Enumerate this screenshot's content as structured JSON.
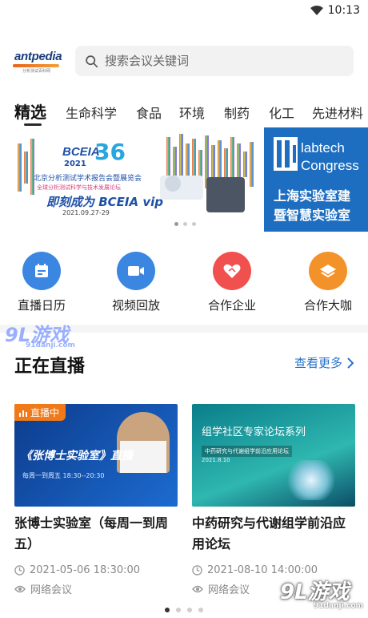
{
  "status_bar": {
    "time": "10:13"
  },
  "header": {
    "logo_text": "antpedia",
    "logo_sub": "分析测试百科网",
    "search_placeholder": "搜索会议关键词"
  },
  "tabs": [
    "精选",
    "生命科学",
    "食品",
    "环境",
    "制药",
    "化工",
    "先进材料"
  ],
  "banners": {
    "main": {
      "brand": "BCEIA",
      "year_badge": "2021",
      "anniversary": "36",
      "line1": "北京分析测试学术报告会暨展览会",
      "line2": "全球分析测试科学与技术发展论坛",
      "cta": "即刻成为 BCEIA vip",
      "date": "2021.09.27-29"
    },
    "side": {
      "title_line1": "labtech",
      "title_line2": "Congress",
      "subtitle_line1": "上海实验室建",
      "subtitle_line2": "暨智慧实验室"
    }
  },
  "shortcuts": [
    {
      "label": "直播日历",
      "icon": "calendar-icon",
      "color": "#3a86e0"
    },
    {
      "label": "视频回放",
      "icon": "video-icon",
      "color": "#3a86e0"
    },
    {
      "label": "合作企业",
      "icon": "heart-handshake-icon",
      "color": "#f0504e"
    },
    {
      "label": "合作大咖",
      "icon": "layers-icon",
      "color": "#f4922a"
    }
  ],
  "live_section": {
    "title": "正在直播",
    "more": "查看更多"
  },
  "cards": [
    {
      "badge": "直播中",
      "thumb_title": "《张博士实验室》直播",
      "thumb_time": "每周一到周五 18:30--20:30",
      "title": "张博士实验室（每周一到周五）",
      "datetime": "2021-05-06 18:30:00",
      "type": "网络会议"
    },
    {
      "thumb_title": "组学社区专家论坛系列",
      "thumb_sub": "中药研究与代谢组学前沿应用论坛",
      "thumb_date": "2021.8.10",
      "title": "中药研究与代谢组学前沿应用论坛",
      "datetime": "2021-08-10 14:00:00",
      "type": "网络会议"
    }
  ],
  "watermark": {
    "text_left": "9L游戏",
    "sub_left": "91danji.com",
    "text_right": "9L游戏",
    "sub_right": "91danji.com"
  },
  "colors": {
    "accent": "#2a72c8",
    "live_badge": "#f07a1a"
  }
}
